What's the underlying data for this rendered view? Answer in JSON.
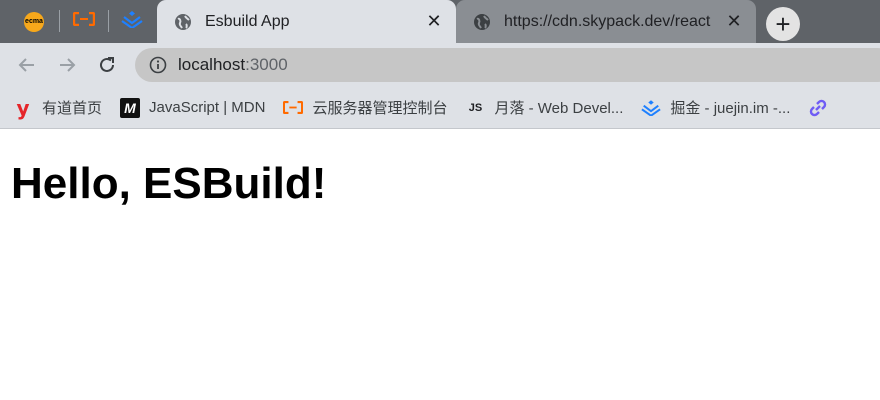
{
  "browser": {
    "pinned_tabs": [
      {
        "name": "ecma-tab",
        "icon": "ecma-icon",
        "icon_text": "ecma"
      },
      {
        "name": "aliyun-tab",
        "icon": "aliyun-icon"
      },
      {
        "name": "juejin-tab",
        "icon": "juejin-icon"
      }
    ],
    "tabs": [
      {
        "title": "Esbuild App",
        "icon": "globe-icon",
        "active": true,
        "close": "✕"
      },
      {
        "title": "https://cdn.skypack.dev/react",
        "icon": "globe-icon",
        "active": false,
        "close": "✕"
      }
    ],
    "new_tab": "+",
    "address_bar": {
      "host": "localhost",
      "port": ":3000"
    },
    "bookmarks": [
      {
        "label": "有道首页",
        "icon": "youdao-icon",
        "icon_text": "y"
      },
      {
        "label": "JavaScript | MDN",
        "icon": "mdn-icon",
        "icon_text": "M"
      },
      {
        "label": "云服务器管理控制台",
        "icon": "aliyun-icon"
      },
      {
        "label": "月落 - Web Devel...",
        "icon": "js-icon",
        "icon_text": "JS"
      },
      {
        "label": "掘金 - juejin.im -...",
        "icon": "juejin-icon"
      },
      {
        "label": "",
        "icon": "link-icon"
      }
    ]
  },
  "page": {
    "heading": "Hello, ESBuild!"
  },
  "colors": {
    "tabstrip": "#5f6368",
    "active_tab": "#dee1e6",
    "aliyun_orange": "#ff6a00",
    "juejin_blue": "#1e80ff"
  }
}
